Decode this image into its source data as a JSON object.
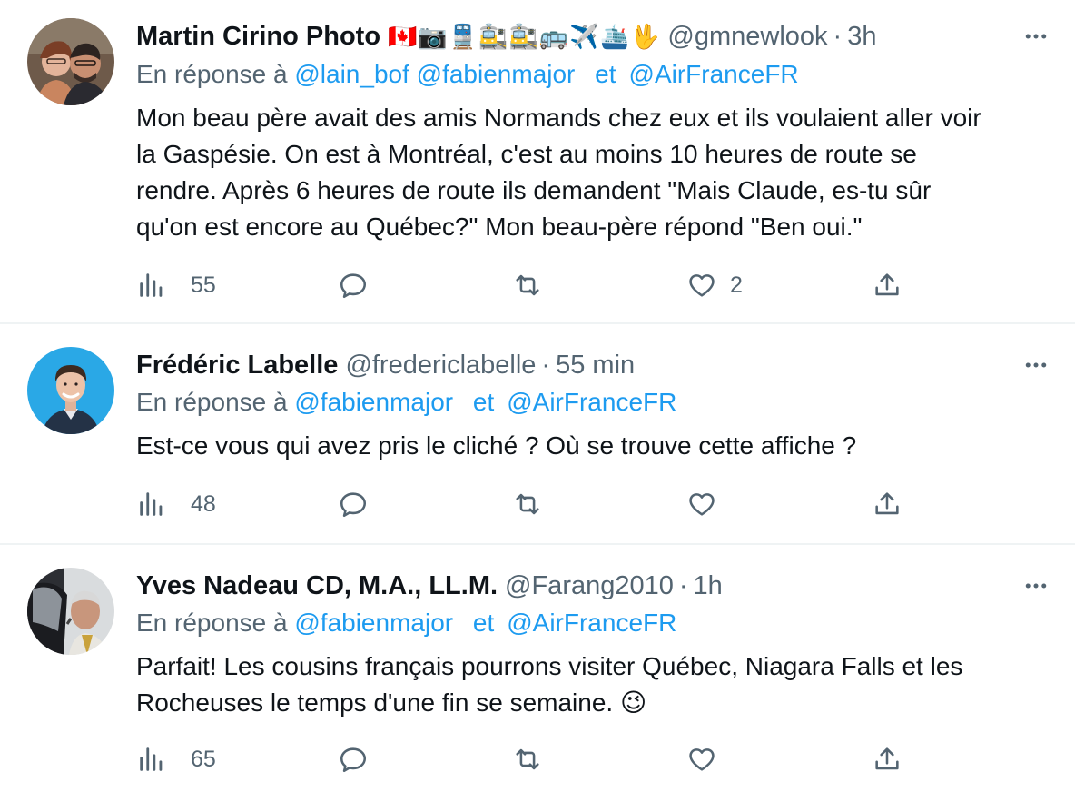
{
  "tweets": [
    {
      "name": "Martin Cirino Photo",
      "emojis": "🇨🇦📷🚆🚉🚉🚌✈️🛳️🖖",
      "handle": "@gmnewlook",
      "time": "3h",
      "reply_prefix": "En réponse à",
      "mentions": [
        "@lain_bof",
        "@fabienmajor",
        "@AirFranceFR"
      ],
      "conjunction": "et",
      "text_lines": [
        "Mon beau père avait des amis Normands chez eux et ils voulaient aller voir",
        "la Gaspésie. On est à Montréal, c'est au moins 10 heures de route se",
        "rendre. Après 6 heures de route ils demandent \"Mais Claude, es-tu sûr",
        "qu'on est encore au Québec?\" Mon beau-père répond \"Ben oui.\""
      ],
      "views": "55",
      "likes": "2"
    },
    {
      "name": "Frédéric Labelle",
      "handle": "@fredericlabelle",
      "time": "55 min",
      "reply_prefix": "En réponse à",
      "mentions": [
        "@fabienmajor",
        "@AirFranceFR"
      ],
      "conjunction": "et",
      "text_lines": [
        "Est-ce vous qui avez pris le cliché ? Où se trouve cette affiche ?"
      ],
      "views": "48"
    },
    {
      "name": "Yves Nadeau CD, M.A., LL.M.",
      "handle": "@Farang2010",
      "time": "1h",
      "reply_prefix": "En réponse à",
      "mentions": [
        "@fabienmajor",
        "@AirFranceFR"
      ],
      "conjunction": "et",
      "text_lines": [
        "Parfait! Les cousins français pourrons visiter Québec, Niagara Falls et les",
        "Rocheuses le temps d'une fin se semaine. 😉"
      ],
      "views": "65"
    }
  ],
  "separator": "·",
  "colors": {
    "text": "#0f1419",
    "secondary": "#536471",
    "link": "#1d9bf0",
    "divider": "#eff3f4"
  },
  "icons": [
    "views-icon",
    "reply-icon",
    "retweet-icon",
    "like-icon",
    "share-icon",
    "more-icon"
  ]
}
